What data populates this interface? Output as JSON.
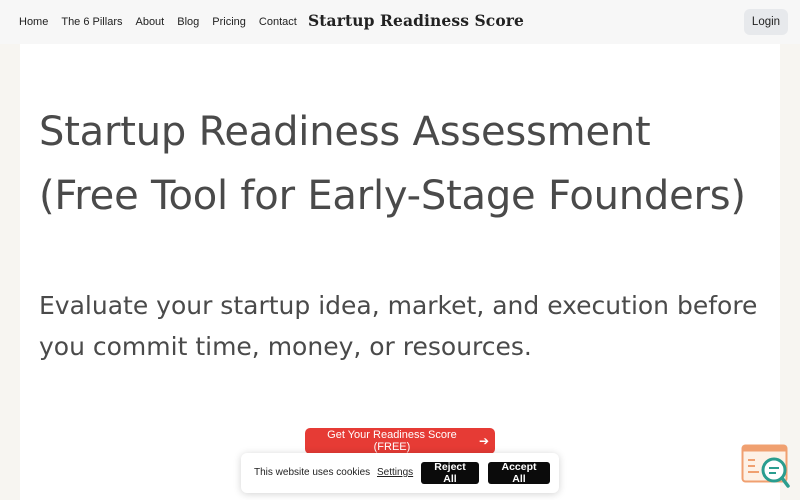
{
  "header": {
    "nav": [
      "Home",
      "The 6 Pillars",
      "About",
      "Blog",
      "Pricing",
      "Contact"
    ],
    "brand": "Startup Readiness Score",
    "login_label": "Login"
  },
  "hero": {
    "title": "Startup Readiness Assessment (Free Tool for Early-Stage Founders)",
    "subtitle": "Evaluate your startup idea, market, and execution before you commit time, money, or resources.",
    "cta_label": "Get Your Readiness Score (FREE)",
    "cta_icon": "arrow-right-icon"
  },
  "cookie_banner": {
    "text": "This website uses cookies",
    "settings_label": "Settings",
    "reject_label": "Reject All",
    "accept_label": "Accept All"
  },
  "chat_widget": {
    "icon": "search-chat-icon"
  },
  "colors": {
    "accent": "#e63b35",
    "widget_orange": "#f0a070",
    "widget_teal": "#2a9d8f"
  }
}
